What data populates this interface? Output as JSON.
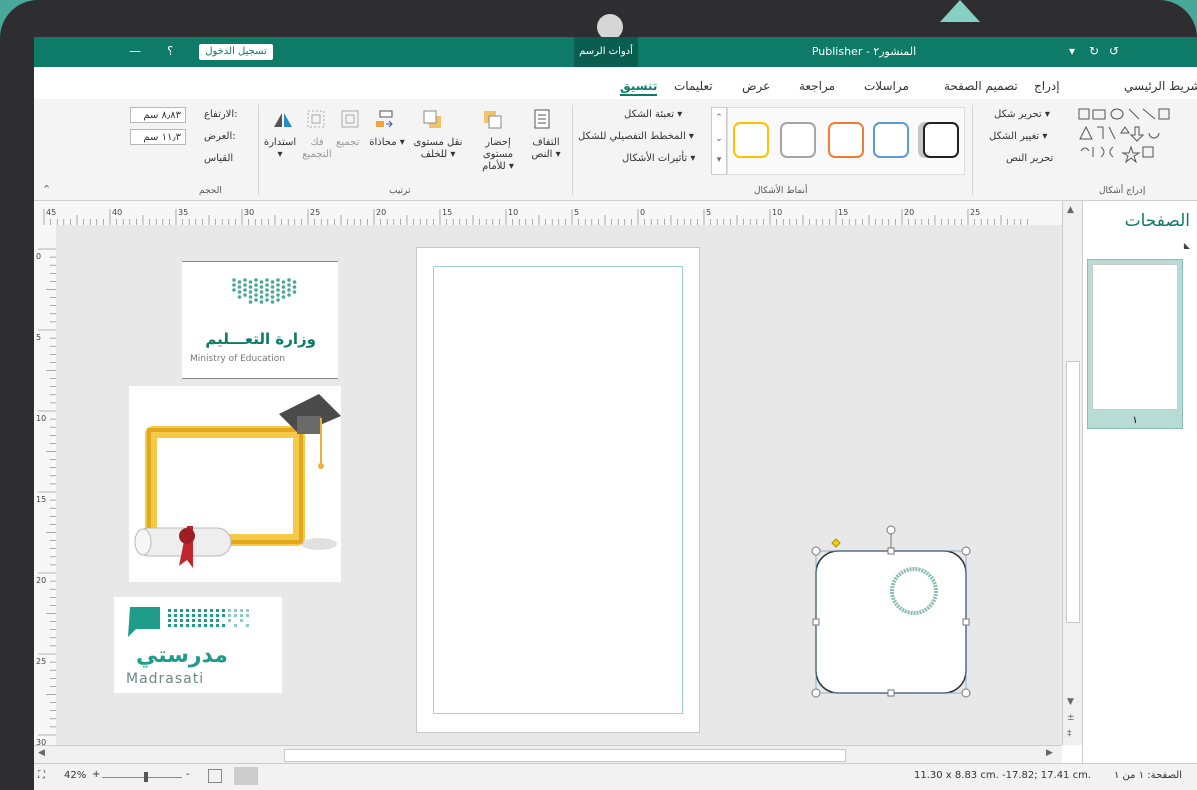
{
  "titlebar": {
    "signin_label": "تسجيل الدخول",
    "help_glyph": "؟",
    "minimize_glyph": "—",
    "tools_tab": "أدوات الرسم",
    "app_title": "Publisher - المنشور٢"
  },
  "tabs": [
    {
      "label": "الشريط الرئيسي"
    },
    {
      "label": "إدراج"
    },
    {
      "label": "تصميم الصفحة"
    },
    {
      "label": "مراسلات"
    },
    {
      "label": "مراجعة"
    },
    {
      "label": "عرض"
    },
    {
      "label": "تعليمات"
    },
    {
      "label": "تنسيق"
    }
  ],
  "ribbon": {
    "insert_shapes": {
      "edit_shape": "تحرير شكل ▾",
      "change_shape": "تغيير الشكل ▾",
      "edit_text": "تحرير النص",
      "group_label": "إدراج أشكال"
    },
    "shape_styles": {
      "fill": "تعبئة الشكل ▾",
      "outline": "المخطط التفصيلي للشكل ▾",
      "effects": "تأثيرات الأشكال ▾",
      "group_label": "أنماط الأشكال",
      "swatch_colors": [
        "#222222",
        "#5b9bd5",
        "#ed7d31",
        "#a5a5a5",
        "#ffc000"
      ]
    },
    "arrange": {
      "wrap": "التفاف النص ▾",
      "bring_forward": "إحضار مستوى للأمام ▾",
      "send_backward": "نقل مستوى للخلف ▾",
      "align": "محاذاة ▾",
      "group": "تجميع",
      "ungroup": "فك التجميع",
      "rotate": "استدارة ▾",
      "group_label": "ترتيب"
    },
    "size": {
      "height_label": "الارتفاع:",
      "height_value": "٨٫٨٣ سم",
      "width_label": "العرض:",
      "width_value": "١١٫٣ سم",
      "measure": "القياس",
      "group_label": "الحجم"
    }
  },
  "ruler": {
    "h_ticks": [
      "45",
      "40",
      "35",
      "30",
      "25",
      "20",
      "15",
      "10",
      "5",
      "0",
      "5",
      "10",
      "15",
      "20",
      "25"
    ],
    "v_ticks": [
      "0",
      "5",
      "10",
      "15",
      "20",
      "25",
      "30"
    ]
  },
  "canvas": {
    "moe_logo_text": "وزارة التعـــليم",
    "moe_logo_en": "Ministry of Education",
    "madrasati_ar": "مدرستي",
    "madrasati_en": "Madrasati"
  },
  "pages_pane": {
    "title": "الصفحات",
    "page_number": "١"
  },
  "statusbar": {
    "page_info": "الصفحة: ١ من ١",
    "position": "-17.82; 17.41 cm.",
    "size": "11.30 x  8.83 cm.",
    "zoom": "42%"
  },
  "colors": {
    "brand": "#0e7a68",
    "accent_teal": "#4aa89a"
  }
}
